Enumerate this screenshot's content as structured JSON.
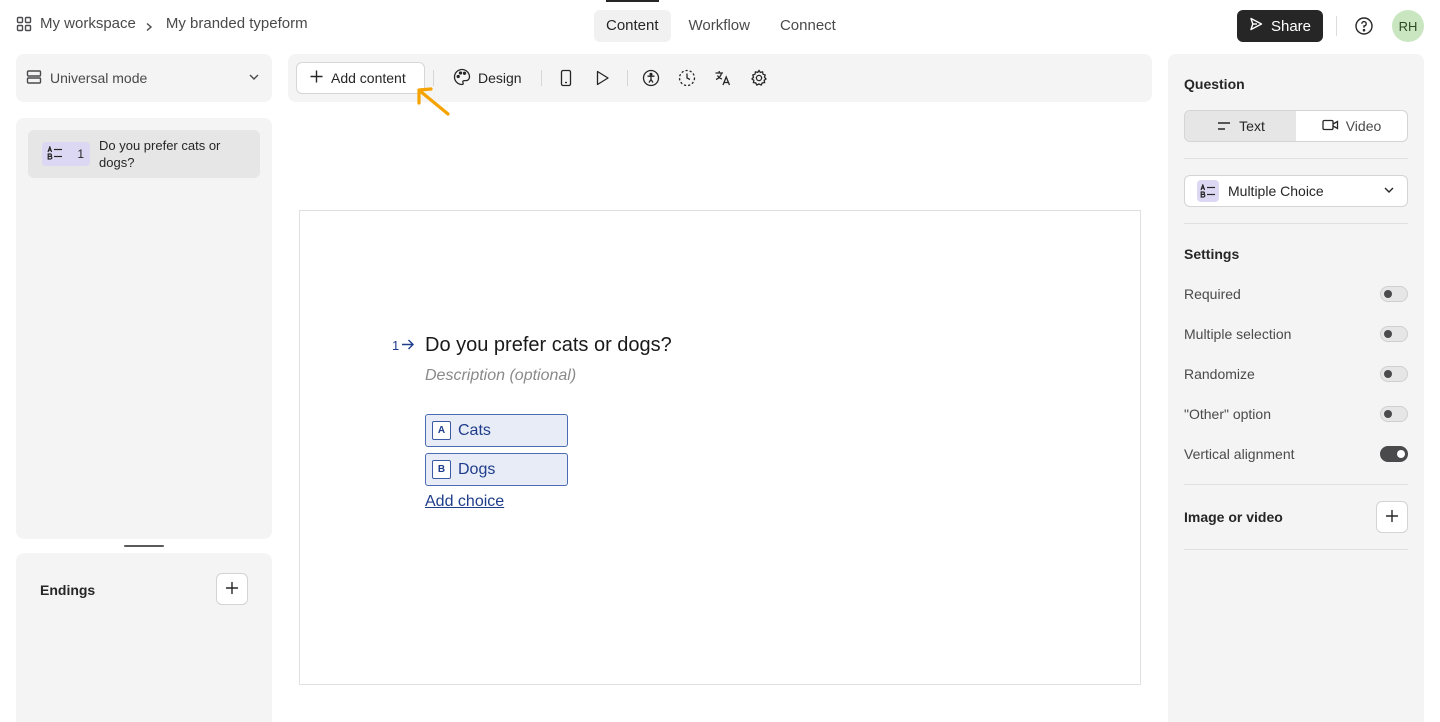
{
  "breadcrumb": {
    "workspace": "My workspace",
    "form_name": "My branded typeform"
  },
  "nav_tabs": [
    {
      "label": "Content",
      "active": true
    },
    {
      "label": "Workflow",
      "active": false
    },
    {
      "label": "Connect",
      "active": false
    }
  ],
  "header": {
    "share_label": "Share",
    "avatar_initials": "RH"
  },
  "mode": {
    "label": "Universal mode"
  },
  "questions": [
    {
      "number": "1",
      "text": "Do you prefer cats or dogs?"
    }
  ],
  "endings": {
    "title": "Endings"
  },
  "toolbar": {
    "add_content_label": "Add content",
    "design_label": "Design",
    "icons": [
      "mobile-preview-icon",
      "play-icon",
      "accessibility-icon",
      "loading-icon",
      "translate-icon",
      "gear-icon"
    ]
  },
  "canvas": {
    "question_number": "1",
    "question_title": "Do you prefer cats or dogs?",
    "description_placeholder": "Description (optional)",
    "choices": [
      {
        "key": "A",
        "label": "Cats"
      },
      {
        "key": "B",
        "label": "Dogs"
      }
    ],
    "add_choice_label": "Add choice"
  },
  "right_panel": {
    "question_heading": "Question",
    "format_options": [
      {
        "label": "Text",
        "active": true
      },
      {
        "label": "Video",
        "active": false
      }
    ],
    "question_type": "Multiple Choice",
    "settings_heading": "Settings",
    "settings": [
      {
        "label": "Required",
        "on": false
      },
      {
        "label": "Multiple selection",
        "on": false
      },
      {
        "label": "Randomize",
        "on": false
      },
      {
        "label": "\"Other\" option",
        "on": false
      },
      {
        "label": "Vertical alignment",
        "on": true
      }
    ],
    "image_or_video_label": "Image or video"
  },
  "colors": {
    "accent_dark": "#262627",
    "choice_blue": "#1f3d8c",
    "annotation_orange": "#f5a300",
    "avatar_bg": "#c9e6c1",
    "badge_purple": "#dcd8f3"
  }
}
